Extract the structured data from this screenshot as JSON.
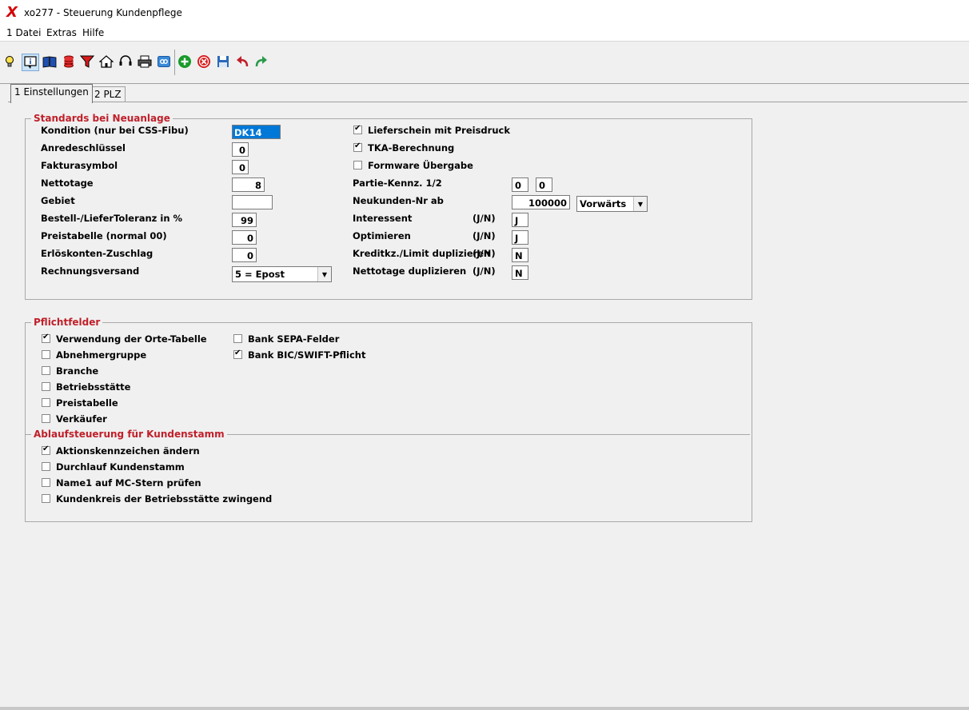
{
  "window": {
    "logo": "X",
    "title": "xo277 - Steuerung Kundenpflege"
  },
  "menu": [
    "1 Datei",
    "Extras",
    "Hilfe"
  ],
  "toolbar": {
    "icons": [
      "lightbulb-icon",
      "info-icon",
      "book-icon",
      "database-icon",
      "filter-icon",
      "home-icon",
      "headset-icon",
      "printer-icon",
      "link-icon",
      "add-icon",
      "delete-icon",
      "save-icon",
      "undo-icon",
      "redo-icon"
    ],
    "colors": {
      "add": "#1a9a2a",
      "delete": "#d81b1b",
      "undo": "#c0202a",
      "redo": "#2a9a4a",
      "save": "#2a6ab8"
    }
  },
  "tabs": [
    "1 Einstellungen",
    "2 PLZ"
  ],
  "standards": {
    "title": "Standards bei Neuanlage",
    "left": [
      {
        "label": "Kondition (nur bei CSS-Fibu)",
        "value": "DK14"
      },
      {
        "label": "Anredeschlüssel",
        "value": "0"
      },
      {
        "label": "Fakturasymbol",
        "value": "0"
      },
      {
        "label": "Nettotage",
        "value": "8"
      },
      {
        "label": "Gebiet",
        "value": ""
      },
      {
        "label": "Bestell-/LieferToleranz in %",
        "value": "99"
      },
      {
        "label": "Preistabelle (normal 00)",
        "value": "0"
      },
      {
        "label": "Erlöskonten-Zuschlag",
        "value": "0"
      },
      {
        "label": "Rechnungsversand",
        "value": "5 = Epost"
      }
    ],
    "checks": [
      {
        "label": "Lieferschein mit Preisdruck",
        "checked": true
      },
      {
        "label": "TKA-Berechnung",
        "checked": true
      },
      {
        "label": "Formware Übergabe",
        "checked": false
      }
    ],
    "partie": {
      "label": "Partie-Kennz. 1/2",
      "v1": "0",
      "v2": "0"
    },
    "neukunden": {
      "label": "Neukunden-Nr ab",
      "value": "100000",
      "direction": "Vorwärts"
    },
    "yn": [
      {
        "label": "Interessent",
        "hint": "(J/N)",
        "value": "J"
      },
      {
        "label": "Optimieren",
        "hint": "(J/N)",
        "value": "J"
      },
      {
        "label": "Kreditkz./Limit duplizieren",
        "hint": "(J/N)",
        "value": "N"
      },
      {
        "label": "Nettotage duplizieren",
        "hint": "(J/N)",
        "value": "N"
      }
    ]
  },
  "pflichtfelder": {
    "title": "Pflichtfelder",
    "left": [
      {
        "label": "Verwendung der Orte-Tabelle",
        "checked": true
      },
      {
        "label": "Abnehmergruppe",
        "checked": false
      },
      {
        "label": "Branche",
        "checked": false
      },
      {
        "label": "Betriebsstätte",
        "checked": false
      },
      {
        "label": "Preistabelle",
        "checked": false
      },
      {
        "label": "Verkäufer",
        "checked": false
      }
    ],
    "right": [
      {
        "label": "Bank SEPA-Felder",
        "checked": false
      },
      {
        "label": "Bank BIC/SWIFT-Pflicht",
        "checked": true
      }
    ]
  },
  "ablauf": {
    "title": "Ablaufsteuerung für Kundenstamm",
    "items": [
      {
        "label": "Aktionskennzeichen ändern",
        "checked": true
      },
      {
        "label": "Durchlauf Kundenstamm",
        "checked": false
      },
      {
        "label": "Name1 auf MC-Stern prüfen",
        "checked": false
      },
      {
        "label": "Kundenkreis der Betriebsstätte zwingend",
        "checked": false
      }
    ]
  }
}
